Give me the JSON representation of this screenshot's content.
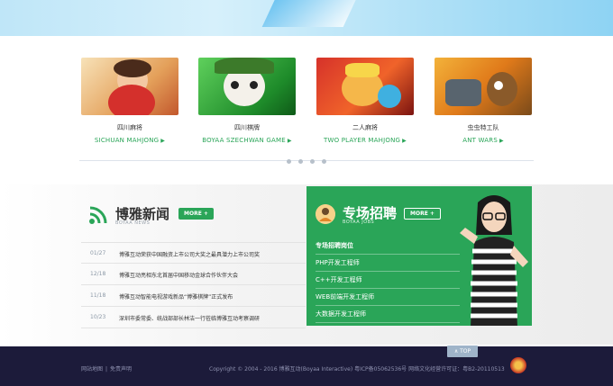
{
  "games": [
    {
      "name": "四川麻将",
      "en": "SICHUAN MAHJONG"
    },
    {
      "name": "四川棋牌",
      "en": "BOYAA SZECHWAN GAME"
    },
    {
      "name": "二人麻将",
      "en": "TWO PLAYER MAHJONG"
    },
    {
      "name": "虫虫特工队",
      "en": "ANT WARS"
    }
  ],
  "news": {
    "title": "博雅新闻",
    "subtitle": "BOYAA NEWS",
    "more": "MORE",
    "items": [
      {
        "date": "01/27",
        "text": "博雅互动荣获中国融资上市公司大奖之最具潜力上市公司奖"
      },
      {
        "date": "12/18",
        "text": "博雅互动亮相东北首届中国移动金球合作伙伴大会"
      },
      {
        "date": "11/18",
        "text": "博雅互动智能电视游戏新品“博雅棋牌”正式发布"
      },
      {
        "date": "10/23",
        "text": "深圳市委常委、统战部部长林洁一行莅临博雅互动考察调研"
      }
    ]
  },
  "jobs": {
    "title": "专场招聘",
    "subtitle": "BOYAA JOBS",
    "more": "MORE",
    "items": [
      "专场招聘岗位",
      "PHP开发工程师",
      "C++开发工程师",
      "WEB前端开发工程师",
      "大数据开发工程师"
    ]
  },
  "footer": {
    "links": [
      "网站地图",
      "|",
      "免责声明"
    ],
    "copyright": "Copyright © 2004 - 2016 博雅互动(Boyaa Interactive) 粤ICP备05062536号  网络文化经营许可证：粤B2-20110513",
    "top_label": "∧ TOP"
  },
  "colors": {
    "accent": "#2aa558",
    "footer": "#1c1b3a"
  }
}
